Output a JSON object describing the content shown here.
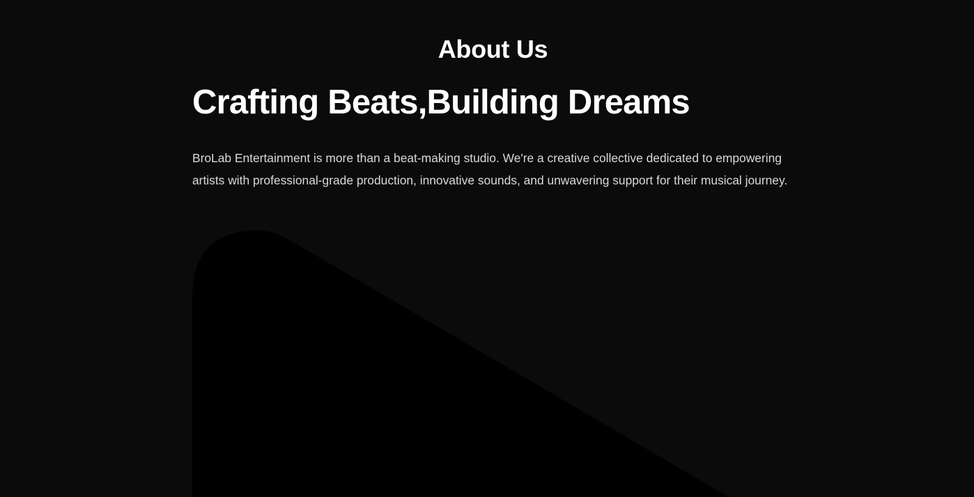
{
  "about": {
    "section_label": "About Us",
    "headline": "Crafting Beats,Building Dreams",
    "description": "BroLab Entertainment is more than a beat-making studio. We're a creative collective dedicated to empowering artists with professional-grade production, innovative sounds, and unwavering support for their musical journey."
  },
  "colors": {
    "background": "#0b0b0b",
    "text": "#ffffff",
    "body_text": "#d9d9d9",
    "shape": "#000000"
  }
}
